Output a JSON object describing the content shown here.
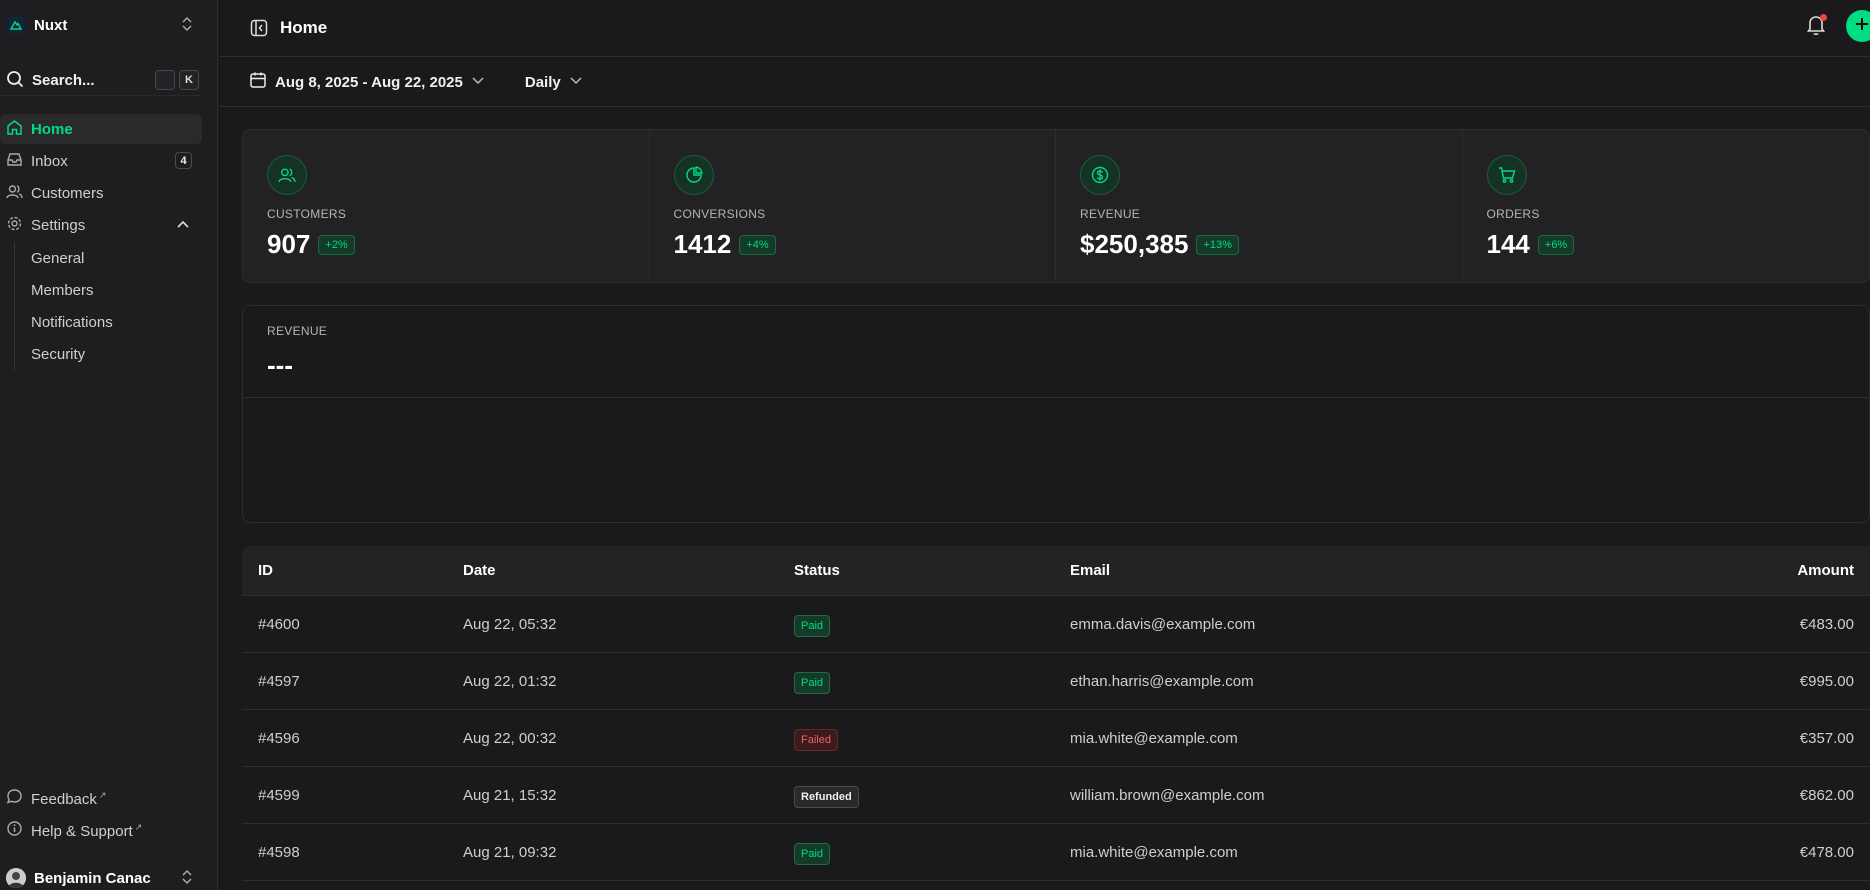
{
  "sidebar": {
    "team_name": "Nuxt",
    "search_label": "Search...",
    "search_kbd": "K",
    "items": [
      {
        "label": "Home",
        "icon": "home-icon"
      },
      {
        "label": "Inbox",
        "icon": "inbox-icon",
        "badge": "4"
      },
      {
        "label": "Customers",
        "icon": "users-icon"
      },
      {
        "label": "Settings",
        "icon": "gear-icon"
      }
    ],
    "settings_sub": [
      "General",
      "Members",
      "Notifications",
      "Security"
    ],
    "footer": [
      {
        "label": "Feedback",
        "icon": "chat-icon"
      },
      {
        "label": "Help & Support",
        "icon": "info-icon"
      }
    ],
    "user_name": "Benjamin Canac"
  },
  "header": {
    "title": "Home"
  },
  "toolbar": {
    "date_range": "Aug 8, 2025 - Aug 22, 2025",
    "period": "Daily"
  },
  "stats": [
    {
      "label": "CUSTOMERS",
      "value": "907",
      "change": "+2%",
      "icon": "users-icon"
    },
    {
      "label": "CONVERSIONS",
      "value": "1412",
      "change": "+4%",
      "icon": "pie-chart-icon"
    },
    {
      "label": "REVENUE",
      "value": "$250,385",
      "change": "+13%",
      "icon": "dollar-circle-icon"
    },
    {
      "label": "ORDERS",
      "value": "144",
      "change": "+6%",
      "icon": "cart-icon"
    }
  ],
  "revenue": {
    "label": "REVENUE",
    "value": "---"
  },
  "table": {
    "headers": [
      "ID",
      "Date",
      "Status",
      "Email",
      "Amount"
    ],
    "rows": [
      [
        "#4600",
        "Aug 22, 05:32",
        "Paid",
        "emma.davis@example.com",
        "€483.00"
      ],
      [
        "#4597",
        "Aug 22, 01:32",
        "Paid",
        "ethan.harris@example.com",
        "€995.00"
      ],
      [
        "#4596",
        "Aug 22, 00:32",
        "Failed",
        "mia.white@example.com",
        "€357.00"
      ],
      [
        "#4599",
        "Aug 21, 15:32",
        "Refunded",
        "william.brown@example.com",
        "€862.00"
      ],
      [
        "#4598",
        "Aug 21, 09:32",
        "Paid",
        "mia.white@example.com",
        "€478.00"
      ]
    ]
  },
  "colors": {
    "accent": "#00dc82",
    "background": "#1a1a1c",
    "danger": "#ef6262"
  }
}
